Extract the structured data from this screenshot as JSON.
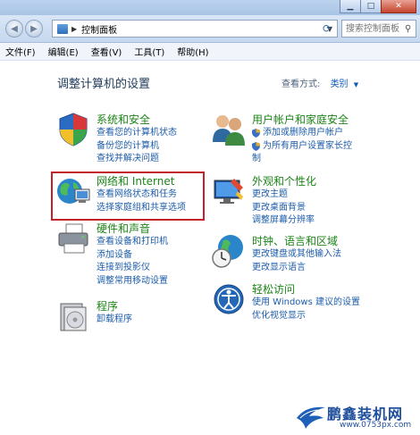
{
  "address": {
    "segment": "控制面板"
  },
  "search": {
    "placeholder": "搜索控制面板"
  },
  "menu": [
    "文件(F)",
    "编辑(E)",
    "查看(V)",
    "工具(T)",
    "帮助(H)"
  ],
  "page": {
    "title": "调整计算机的设置",
    "view_by_label": "查看方式:",
    "view_by_value": "类别"
  },
  "categories": {
    "system": {
      "title": "系统和安全",
      "links": [
        "查看您的计算机状态",
        "备份您的计算机",
        "查找并解决问题"
      ]
    },
    "network": {
      "title": "网络和 Internet",
      "links": [
        "查看网络状态和任务",
        "选择家庭组和共享选项"
      ]
    },
    "hardware": {
      "title": "硬件和声音",
      "links": [
        "查看设备和打印机",
        "添加设备",
        "连接到投影仪",
        "调整常用移动设置"
      ]
    },
    "programs": {
      "title": "程序",
      "links": [
        "卸载程序"
      ]
    },
    "users": {
      "title": "用户帐户和家庭安全",
      "links": [
        "添加或删除用户帐户",
        "为所有用户设置家长控",
        "制"
      ]
    },
    "appearance": {
      "title": "外观和个性化",
      "links": [
        "更改主题",
        "更改桌面背景",
        "调整屏幕分辨率"
      ]
    },
    "clock": {
      "title": "时钟、语言和区域",
      "links": [
        "更改键盘或其他输入法",
        "更改显示语言"
      ]
    },
    "ease": {
      "title": "轻松访问",
      "links": [
        "使用 Windows 建议的设置",
        "优化视觉显示"
      ]
    }
  },
  "watermark": {
    "title": "鹏鑫装机网",
    "url": "www.0753px.com"
  }
}
